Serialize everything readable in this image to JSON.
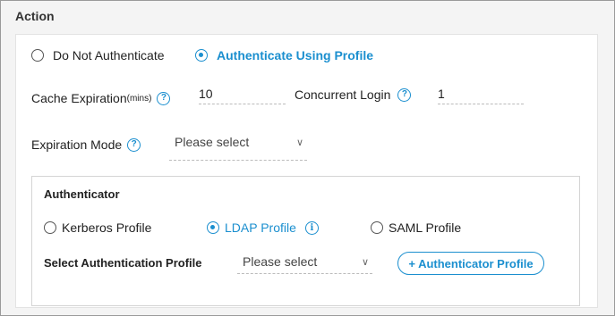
{
  "section": {
    "title": "Action"
  },
  "auth_mode": {
    "options": [
      {
        "label": "Do Not Authenticate",
        "selected": false
      },
      {
        "label": "Authenticate Using Profile",
        "selected": true
      }
    ]
  },
  "cache_expiration": {
    "label": "Cache Expiration",
    "unit": "(mins)",
    "value": "10",
    "help_icon": "question-circle-icon"
  },
  "concurrent_login": {
    "label": "Concurrent Login",
    "value": "1",
    "help_icon": "question-circle-icon"
  },
  "expiration_mode": {
    "label": "Expiration Mode",
    "placeholder": "Please select",
    "help_icon": "question-circle-icon"
  },
  "authenticator": {
    "title": "Authenticator",
    "options": [
      {
        "label": "Kerberos Profile",
        "selected": false
      },
      {
        "label": "LDAP Profile",
        "selected": true
      },
      {
        "label": "SAML Profile",
        "selected": false
      }
    ],
    "info_icon": "info-circle-icon",
    "select_label": "Select Authentication Profile",
    "select_placeholder": "Please select",
    "add_button": "+ Authenticator Profile"
  },
  "colors": {
    "accent": "#1b8fcf",
    "background": "#f4f4f4",
    "panel": "#ffffff"
  }
}
